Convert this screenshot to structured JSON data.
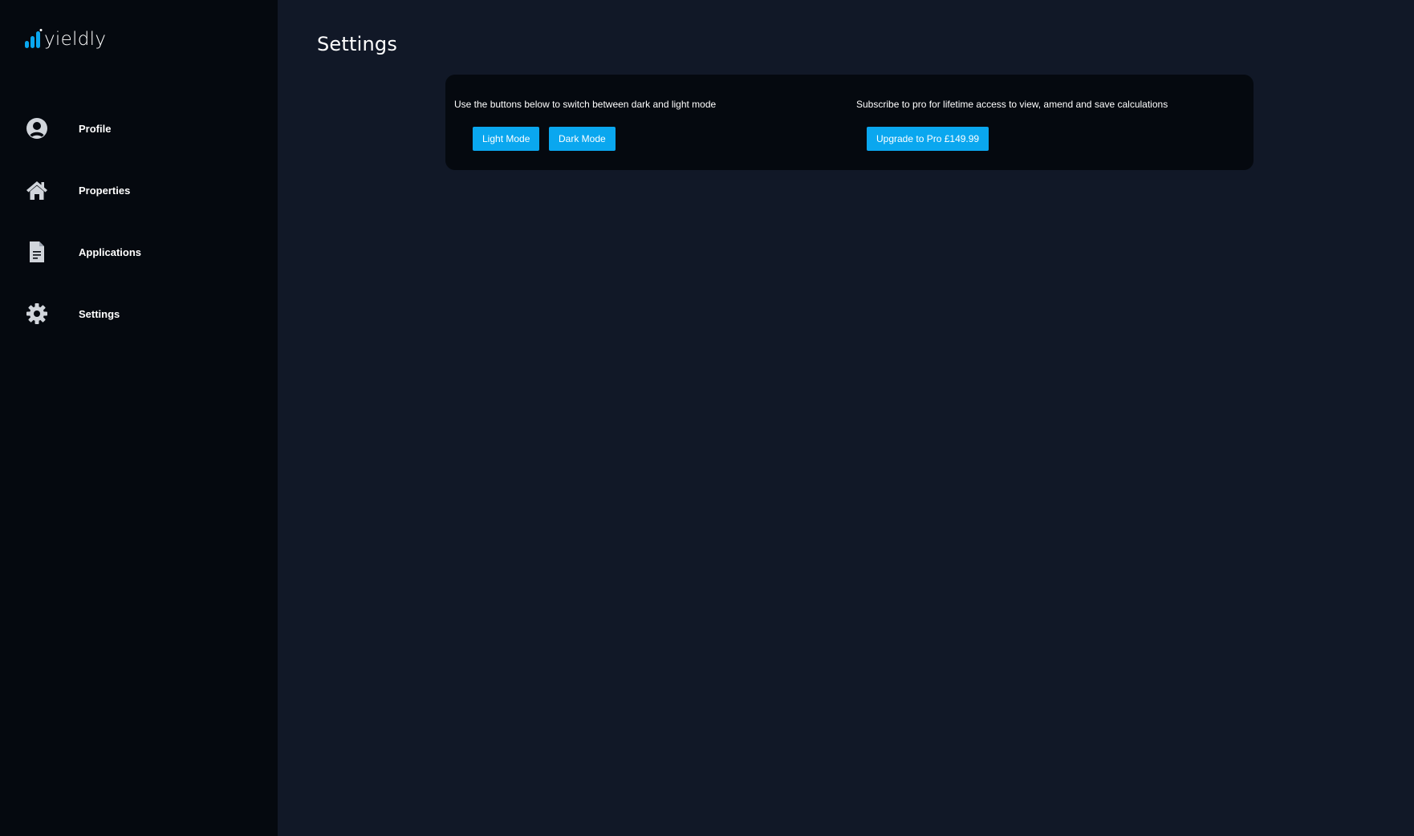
{
  "brand": {
    "name": "yieldly",
    "logo_icon": "bar-chart-logo-icon",
    "accent": "#0aa7ef"
  },
  "sidebar": {
    "items": [
      {
        "label": "Profile",
        "icon": "user-circle-icon"
      },
      {
        "label": "Properties",
        "icon": "home-icon"
      },
      {
        "label": "Applications",
        "icon": "document-icon"
      },
      {
        "label": "Settings",
        "icon": "gear-icon"
      }
    ]
  },
  "main": {
    "title": "Settings",
    "theme": {
      "description": "Use the buttons below to switch between dark and light mode",
      "light_label": "Light Mode",
      "dark_label": "Dark Mode"
    },
    "subscription": {
      "description": "Subscribe to pro for lifetime access to view, amend and save calculations",
      "upgrade_label": "Upgrade to Pro £149.99"
    }
  },
  "colors": {
    "sidebar_bg": "#05090f",
    "main_bg": "#111827",
    "button": "#0aa7ef"
  }
}
